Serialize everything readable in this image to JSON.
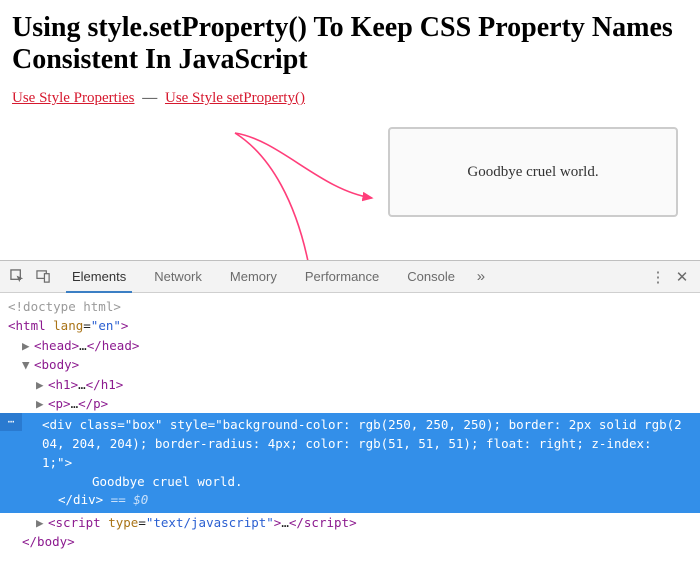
{
  "heading": "Using style.setProperty() To Keep CSS Property Names Consistent In JavaScript",
  "links": {
    "style_props": "Use Style Properties",
    "separator": "—",
    "set_property": "Use Style setProperty()"
  },
  "box": {
    "text": "Goodbye cruel world."
  },
  "devtools": {
    "tabs": {
      "elements": "Elements",
      "network": "Network",
      "memory": "Memory",
      "performance": "Performance",
      "console": "Console",
      "more": "»"
    },
    "dom": {
      "doctype": "<!doctype html>",
      "html_open": "<html lang=\"en\">",
      "head": "<head>…</head>",
      "body_open": "<body>",
      "h1": "<h1>…</h1>",
      "p": "<p>…</p>",
      "selected": {
        "gutter": "⋯",
        "open": "<div class=\"box\" style=\"background-color: rgb(250, 250, 250); border: 2px solid rgb(204, 204, 204); border-radius: 4px; color: rgb(51, 51, 51); float: right; z-index: 1;\">",
        "text": "Goodbye cruel world.",
        "close": "</div>",
        "selref": " == $0"
      },
      "script": "<script type=\"text/javascript\">…</script>",
      "body_close": "</body>"
    }
  }
}
